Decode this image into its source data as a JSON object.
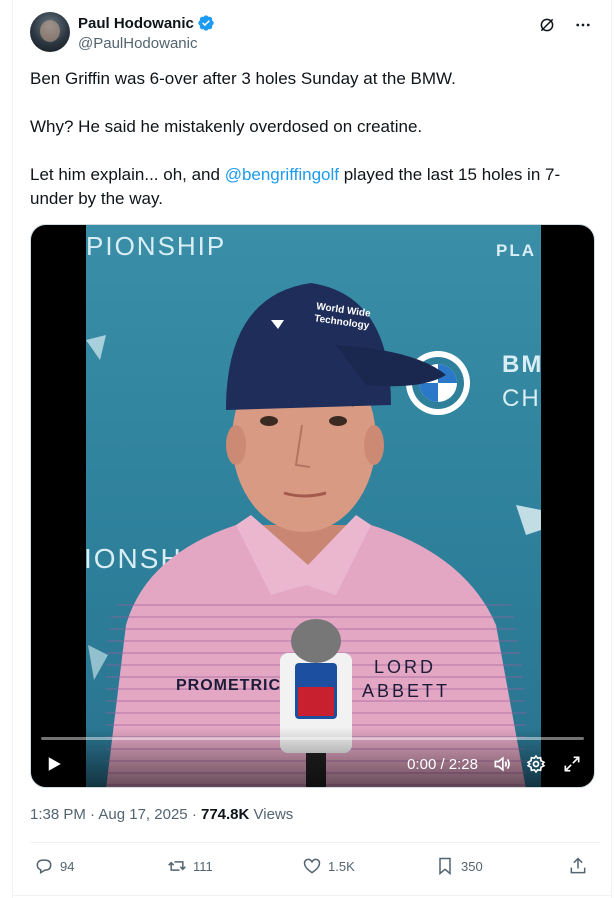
{
  "author": {
    "name": "Paul Hodowanic",
    "handle": "@PaulHodowanic",
    "verified": true
  },
  "header_icons": [
    "grok-icon",
    "more-icon"
  ],
  "tweet": {
    "line1": "Ben Griffin was 6-over after 3 holes Sunday at the BMW.",
    "line2": "Why? He said he mistakenly overdosed on creatine.",
    "line3_before": "Let him explain... oh, and ",
    "line3_mention": "@bengriffingolf",
    "line3_after": " played the last 15 holes in 7-under by the way."
  },
  "video": {
    "time": "0:00 / 2:28",
    "progress": 0,
    "backdrop_text": {
      "top_left": "PIONSHIP",
      "mid_left": "IONSH",
      "top_right_1": "PLA",
      "bmw_1": "BM",
      "bmw_2": "CH"
    },
    "cap_text_1": "World Wide",
    "cap_text_2": "Technology",
    "shirt_left": "PROMETRIC",
    "shirt_right_1": "LORD",
    "shirt_right_2": "ABBETT",
    "mic_flag": "PGA TOUR"
  },
  "meta": {
    "time": "1:38 PM",
    "sep": "·",
    "date": "Aug 17, 2025",
    "views_count": "774.8K",
    "views_label": "Views"
  },
  "actions": {
    "replies": "94",
    "reposts": "111",
    "likes": "1.5K",
    "bookmarks": "350"
  },
  "colors": {
    "accent": "#1d9bf0",
    "secondary_text": "#536471",
    "video_bg": "#2d7f9a"
  }
}
